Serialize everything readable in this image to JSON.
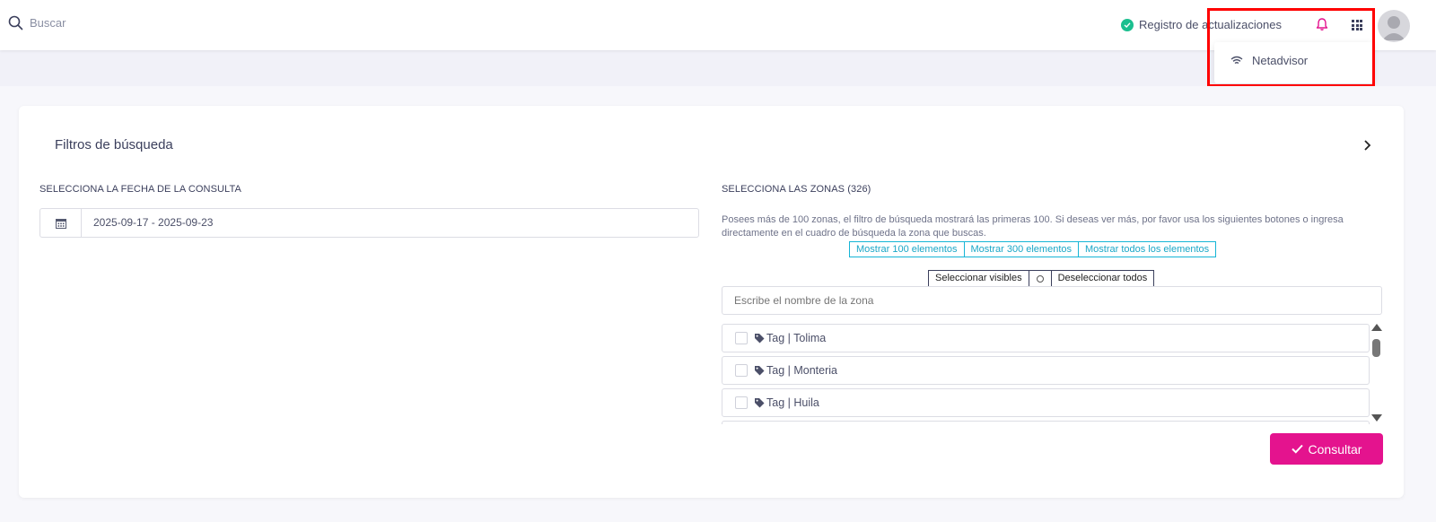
{
  "header": {
    "search_label": "Buscar",
    "updates_label": "Registro de actualizaciones",
    "icons": [
      "search-icon",
      "check-circle-icon",
      "bell-icon",
      "apps-grid-icon",
      "avatar"
    ]
  },
  "dropdown": {
    "item_label": "Netadvisor",
    "item_icon": "wifi-icon"
  },
  "card": {
    "title": "Filtros de búsqueda"
  },
  "date": {
    "label": "SELECCIONA LA FECHA DE LA CONSULTA",
    "value": "2025-09-17 - 2025-09-23"
  },
  "zones": {
    "label": "SELECCIONA LAS ZONAS (326)",
    "note": "Posees más de 100 zonas, el filtro de búsqueda mostrará las primeras 100. Si deseas ver más, por favor usa los siguientes botones o ingresa directamente en el cuadro de búsqueda la zona que buscas.",
    "show_buttons": [
      "Mostrar 100 elementos",
      "Mostrar 300 elementos",
      "Mostrar todos los elementos"
    ],
    "select_visible": "Seleccionar visibles",
    "deselect_all": "Deseleccionar todos",
    "search_placeholder": "Escribe el nombre de la zona",
    "items": [
      "Tag | Tolima",
      "Tag | Monteria",
      "Tag | Huila"
    ]
  },
  "actions": {
    "consultar": "Consultar"
  },
  "colors": {
    "accent": "#e4138e",
    "info": "#16b5d6",
    "success": "#1bbf8f",
    "highlight": "#ff0000"
  }
}
